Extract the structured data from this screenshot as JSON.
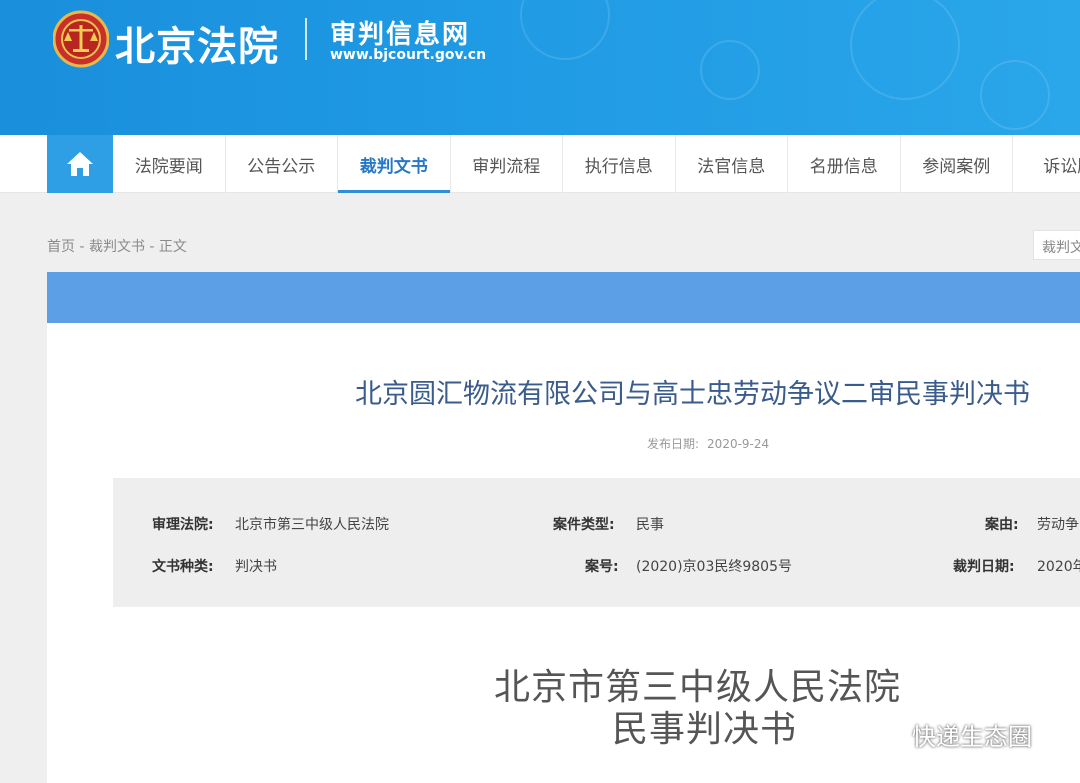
{
  "header": {
    "site_name": "北京法院",
    "sub_title": "审判信息网",
    "sub_url": "www.bjcourt.gov.cn"
  },
  "nav": {
    "home_icon": "home-icon",
    "items": [
      {
        "label": "法院要闻",
        "active": false
      },
      {
        "label": "公告公示",
        "active": false
      },
      {
        "label": "裁判文书",
        "active": true
      },
      {
        "label": "审判流程",
        "active": false
      },
      {
        "label": "执行信息",
        "active": false
      },
      {
        "label": "法官信息",
        "active": false
      },
      {
        "label": "名册信息",
        "active": false
      },
      {
        "label": "参阅案例",
        "active": false
      },
      {
        "label": "诉讼服",
        "active": false
      }
    ]
  },
  "breadcrumb": "首页 - 裁判文书 - 正文",
  "search": {
    "value": "裁判文"
  },
  "document": {
    "title": "北京圆汇物流有限公司与高士忠劳动争议二审民事判决书",
    "publish_label": "发布日期:",
    "publish_date": "2020-9-24",
    "info": {
      "court_label": "审理法院:",
      "court_value": "北京市第三中级人民法院",
      "case_type_label": "案件类型:",
      "case_type_value": "民事",
      "cause_label": "案由:",
      "cause_value": "劳动争",
      "doc_type_label": "文书种类:",
      "doc_type_value": "判决书",
      "case_no_label": "案号:",
      "case_no_value": "(2020)京03民终9805号",
      "judge_date_label": "裁判日期:",
      "judge_date_value": "2020年"
    },
    "court_name": "北京市第三中级人民法院",
    "doc_kind": "民事判决书"
  },
  "watermark": "快递生态圈",
  "colors": {
    "banner": "#1f9ae4",
    "nav_active": "#2777c8",
    "card_bar": "#5c9fe6",
    "title": "#3a5c8c"
  }
}
